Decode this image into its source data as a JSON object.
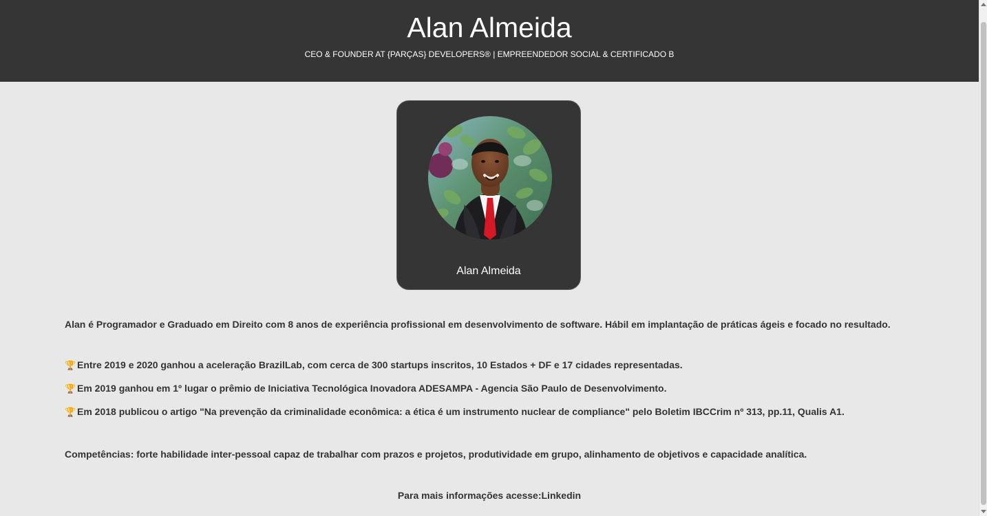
{
  "header": {
    "title": "Alan Almeida",
    "subtitle": "CEO & FOUNDER AT {PARÇAS} DEVELOPERS® | EMPREENDEDOR SOCIAL & CERTIFICADO B"
  },
  "profile_card": {
    "name": "Alan Almeida",
    "avatar_icon": "profile-photo"
  },
  "about": {
    "intro": "Alan é Programador e Graduado em Direito com 8 anos de experiência profissional em desenvolvimento de software. Hábil em implantação de práticas ágeis e focado no resultado.",
    "achievements": [
      {
        "icon": "🏆",
        "text": "Entre 2019 e 2020 ganhou a aceleração BrazilLab, com cerca de 300 startups inscritos, 10 Estados + DF e 17 cidades representadas."
      },
      {
        "icon": "🏆",
        "text": "Em 2019 ganhou em 1º lugar o prêmio de Iniciativa Tecnológica Inovadora ADESAMPA - Agencia São Paulo de Desenvolvimento."
      },
      {
        "icon": "🏆",
        "text": "Em 2018 publicou o artigo \"Na prevenção da criminalidade econômica: a ética é um instrumento nuclear de compliance\" pelo Boletim IBCCrim nº 313, pp.11, Qualis A1."
      }
    ],
    "competencies": "Competências: forte habilidade inter-pessoal capaz de trabalhar com prazos e projetos, produtividade em grupo, alinhamento de objetivos e capacidade analítica."
  },
  "footer": {
    "prefix": "Para mais informações acesse:",
    "link_label": "Linkedin"
  },
  "colors": {
    "header_background": "#353535",
    "page_background": "#e8e8e8",
    "card_background": "#353535",
    "text": "#333333"
  }
}
